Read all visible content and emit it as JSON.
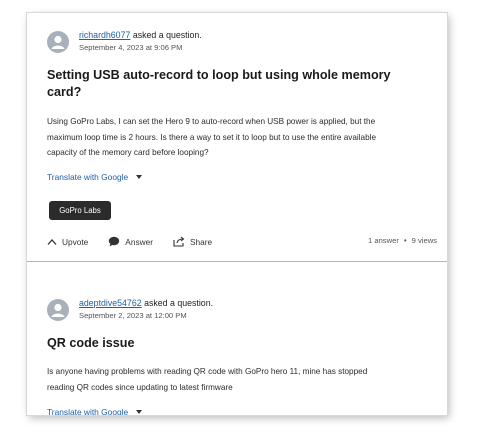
{
  "posts": [
    {
      "author": "richardh6077",
      "asked_text": "asked a question.",
      "date": "September 4, 2023 at 9:06 PM",
      "title_line1": "Setting USB auto-record to loop but using whole memory",
      "title_line2": "card?",
      "body_line1": "Using GoPro Labs, I can set the Hero 9 to auto-record when USB power is applied, but the",
      "body_line2": "maximum loop time is 2 hours. Is there a way to set it to loop but to use the entire available",
      "body_line3": "capacity of the memory card before looping?",
      "translate_label": "Translate with Google",
      "tag": "GoPro Labs",
      "upvote_label": "Upvote",
      "answer_label": "Answer",
      "share_label": "Share",
      "answers_count": "1 answer",
      "views_count": "9 views"
    },
    {
      "author": "adeptdive54762",
      "asked_text": "asked a question.",
      "date": "September 2, 2023 at 12:00 PM",
      "title_line1": "QR code issue",
      "body_line1": "Is anyone having problems with reading QR code with GoPro hero 11, mine has stopped",
      "body_line2": "reading QR codes since updating to latest firmware",
      "translate_label": "Translate with Google"
    }
  ],
  "icons": {
    "avatar": "user-avatar-icon",
    "upvote": "chevron-up-icon",
    "answer": "speech-bubble-icon",
    "share": "share-icon",
    "translate_dropdown": "caret-down-icon"
  },
  "colors": {
    "link": "#1f5fa6",
    "tag_bg": "#2b2b2b",
    "avatar": "#a7b0bb"
  }
}
